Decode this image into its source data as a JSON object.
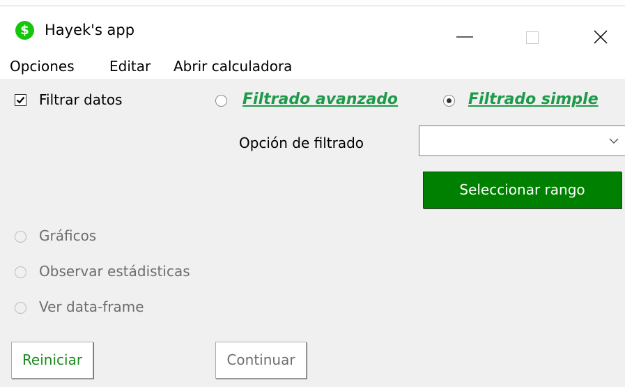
{
  "window": {
    "icon_glyph": "$",
    "title": "Hayek's app",
    "accent_color": "#16c60c"
  },
  "menu": {
    "items": [
      "Opciones",
      "Editar",
      "Abrir calculadora"
    ]
  },
  "filter": {
    "checkbox_label": "Filtrar datos",
    "checkbox_checked": true,
    "advanced_label": "Filtrado avanzado",
    "advanced_selected": false,
    "simple_label": "Filtrado simple",
    "simple_selected": true,
    "option_label": "Opción de filtrado",
    "option_value": "",
    "select_range_label": "Seleccionar rango"
  },
  "actions": {
    "graphics_label": "Gráficos",
    "stats_label": "Observar estádisticas",
    "dataframe_label": "Ver data-frame"
  },
  "buttons": {
    "reset_label": "Reiniciar",
    "continue_label": "Continuar"
  },
  "colors": {
    "link_green": "#1f9a4a",
    "button_green": "#008000",
    "reset_text": "#1a8a1a",
    "continue_text": "#6d6d6d"
  },
  "icons": {
    "minimize": "minimize-icon",
    "maximize": "maximize-icon",
    "close": "close-icon",
    "combo_arrow": "chevron-down-icon",
    "checkmark": "checkmark-icon"
  }
}
